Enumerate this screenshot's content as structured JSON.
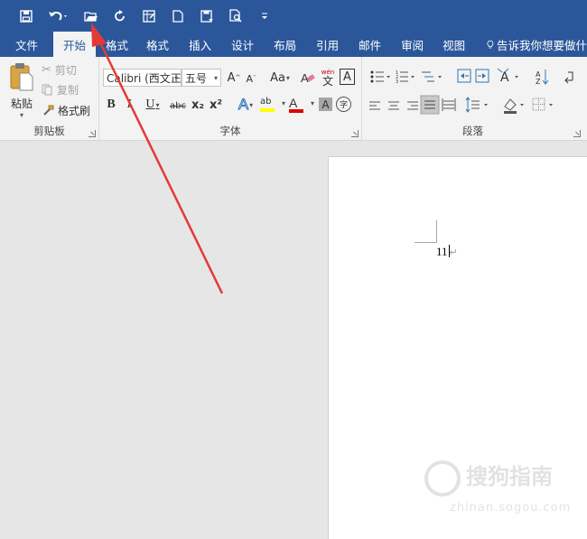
{
  "quick_access": {
    "items": [
      "save-icon",
      "undo-icon",
      "open-icon",
      "redo-icon",
      "table-icon",
      "new-doc-icon",
      "save-as-icon",
      "print-preview-icon",
      "customize-icon"
    ]
  },
  "tabs": {
    "items": [
      {
        "label": "文件",
        "active": false
      },
      {
        "label": "开始",
        "active": true
      },
      {
        "label": "格式",
        "active": false
      },
      {
        "label": "格式",
        "active": false
      },
      {
        "label": "插入",
        "active": false
      },
      {
        "label": "设计",
        "active": false
      },
      {
        "label": "布局",
        "active": false
      },
      {
        "label": "引用",
        "active": false
      },
      {
        "label": "邮件",
        "active": false
      },
      {
        "label": "审阅",
        "active": false
      },
      {
        "label": "视图",
        "active": false
      }
    ],
    "tell_me": "告诉我你想要做什"
  },
  "clipboard": {
    "paste_label": "粘贴",
    "cut_label": "剪切",
    "copy_label": "复制",
    "format_painter_label": "格式刷",
    "group_label": "剪贴板"
  },
  "font": {
    "font_name": "Calibri (西文正",
    "font_size": "五号",
    "group_label": "字体",
    "bold": "B",
    "italic": "I",
    "underline": "U",
    "strike": "abc",
    "subscript": "x₂",
    "superscript": "x²",
    "grow": "A",
    "shrink": "A",
    "change_case": "Aa",
    "pinyin_top": "wén",
    "pinyin_char": "文",
    "char_border": "A",
    "font_color": "A",
    "highlight": "ab",
    "char_shading": "A",
    "enclose": "字"
  },
  "paragraph": {
    "group_label": "段落"
  },
  "document": {
    "text": "11",
    "paragraph_mark": "↵"
  },
  "watermark": {
    "text": "搜狗指南",
    "url": "zhinan.sogou.com"
  },
  "colors": {
    "title_bar": "#2b579a",
    "ribbon": "#f3f3f3",
    "annotation_arrow": "#e53935",
    "font_color_bar": "#e00000",
    "highlight_bar": "#ffff00"
  }
}
